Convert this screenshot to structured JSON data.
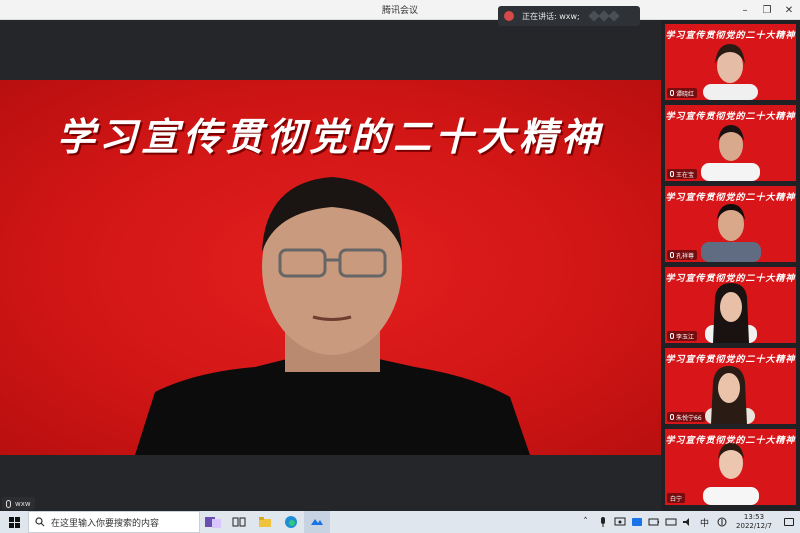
{
  "window": {
    "title": "腾讯会议",
    "controls": {
      "minimize": "–",
      "restore": "❐",
      "close": "✕"
    }
  },
  "speaking_indicator": {
    "label": "正在讲话: wxw;"
  },
  "main_video": {
    "banner": "学习宣传贯彻党的二十大精神",
    "participant_name": "wxw"
  },
  "sidebar": {
    "tiles": [
      {
        "banner": "学习宣传贯彻党的二十大精神",
        "name": "谭晓红"
      },
      {
        "banner": "学习宣传贯彻党的二十大精神",
        "name": "王在宝"
      },
      {
        "banner": "学习宣传贯彻党的二十大精神",
        "name": "孔祥尊"
      },
      {
        "banner": "学习宣传贯彻党的二十大精神",
        "name": "李玉江"
      },
      {
        "banner": "学习宣传贯彻党的二十大精神",
        "name": "朱悦宁66"
      },
      {
        "banner": "学习宣传贯彻党的二十大精神",
        "name": "白宁"
      }
    ]
  },
  "taskbar": {
    "search_placeholder": "在这里输入你要搜索的内容",
    "ime": "中",
    "time": "13:53",
    "date": "2022/12/7"
  },
  "colors": {
    "banner_red": "#d8161a",
    "taskbar": "#dfe6ee",
    "dark_bg": "#242629"
  }
}
